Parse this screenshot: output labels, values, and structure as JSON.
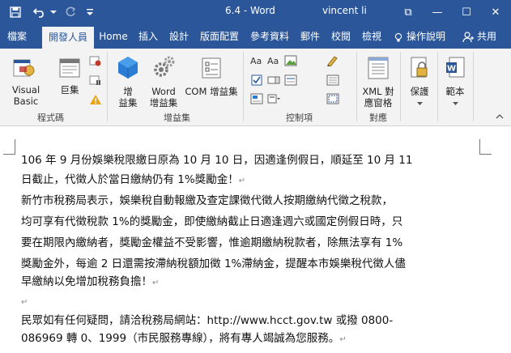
{
  "titlebar": {
    "title": "6.4  -  Word",
    "user": "vincent li",
    "restore_glyph": "⧉",
    "minimize_glyph": "—",
    "maximize_glyph": "☐",
    "close_glyph": "✕"
  },
  "tabs": {
    "file": "檔案",
    "developer": "開發人員",
    "home": "Home",
    "insert": "插入",
    "design": "設計",
    "layout": "版面配置",
    "references": "參考資料",
    "mailings": "郵件",
    "review": "校閱",
    "view": "檢視",
    "tell_me": "操作說明",
    "share": "共用"
  },
  "ribbon": {
    "code": {
      "label": "程式碼",
      "visual_basic": "Visual Basic",
      "macros": "巨集"
    },
    "addins": {
      "label": "增益集",
      "addins_line1": "增",
      "addins_line2": "益集",
      "word_addins_line1": "Word",
      "word_addins_line2": "增益集",
      "com_addins": "COM 增益集"
    },
    "controls": {
      "label": "控制項"
    },
    "mapping": {
      "label": "對應",
      "xml_line1": "XML 對",
      "xml_line2": "應窗格"
    },
    "protect": {
      "label": "保護"
    },
    "templates": {
      "label": "範本"
    }
  },
  "document": {
    "para1_line1": "106 年 9 月份娛樂稅限繳日原為 10 月 10 日，因適逢例假日，順延至 10 月 11",
    "para1_line2": "日截止，代徵人於當日繳納仍有 1%獎勵金！",
    "para2_line1": "  新竹市稅務局表示，娛樂稅自動報繳及查定課徵代徵人按期繳納代徵之稅款，",
    "para2_line2": "均可享有代徵稅款 1%的獎勵金，即使繳納截止日適逢週六或國定例假日時，只",
    "para2_line3": "要在期限內繳納者，獎勵金權益不受影響，惟逾期繳納稅款者，除無法享有 1%",
    "para2_line4": "獎勵金外，每逾 2 日還需按滯納稅額加徵 1%滯納金，提醒本市娛樂稅代徵人儘",
    "para2_line5": "早繳納以免增加稅務負擔！",
    "para3_line1": "  民眾如有任何疑問，請洽稅務局網站：http://www.hcct.gov.tw  或撥 0800-",
    "para3_line2": "086969 轉 0、1999（市民服務專線），將有專人竭誠為您服務。",
    "paragraph_mark": "↵"
  },
  "colors": {
    "accent": "#2b579a",
    "ribbon_bg": "#f3f3f3",
    "text": "#111111"
  }
}
